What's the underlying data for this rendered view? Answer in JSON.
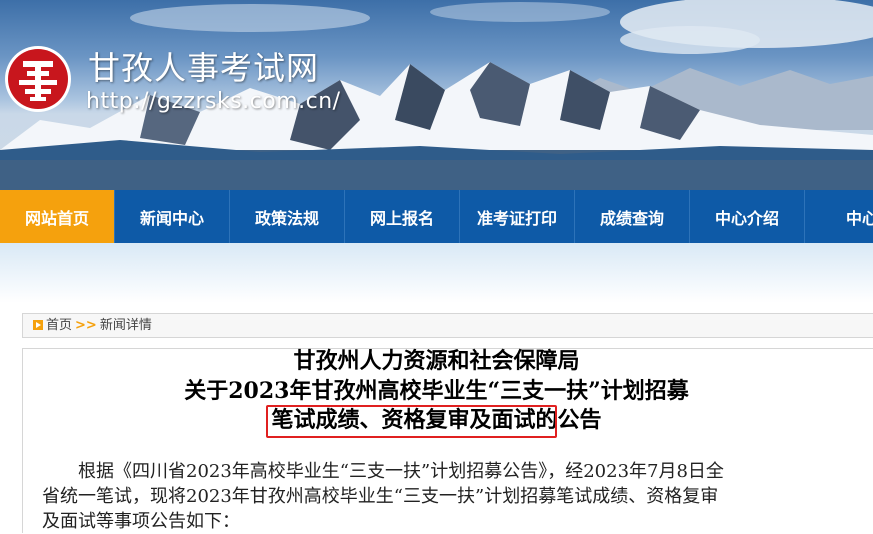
{
  "header": {
    "site_title": "甘孜人事考试网",
    "site_url": "http://gzzrsks.com.cn/"
  },
  "nav": {
    "items": [
      "网站首页",
      "新闻中心",
      "政策法规",
      "网上报名",
      "准考证打印",
      "成绩查询",
      "中心介绍",
      "中心"
    ],
    "active_index": 0
  },
  "breadcrumb": {
    "home": "首页",
    "separator": ">>",
    "current": "新闻详情"
  },
  "article": {
    "title_line1": "甘孜州人力资源和社会保障局",
    "title_line2": "关于2023年甘孜州高校毕业生“三支一扶”计划招募",
    "title_line3": "笔试成绩、资格复审及面试的公告",
    "body_line1": "根据《四川省2023年高校毕业生“三支一扶”计划招募公告》，经2023年7月8日全",
    "body_line2": "省统一笔试，现将2023年甘孜州高校毕业生“三支一扶”计划招募笔试成绩、资格复审",
    "body_line3": "及面试等事项公告如下："
  },
  "colors": {
    "nav_bg": "#0e5aa7",
    "nav_active": "#f5a10d",
    "highlight_border": "#e02020",
    "logo_red": "#c8161d"
  },
  "icons": [
    "logo-seal-icon",
    "breadcrumb-arrow-icon"
  ]
}
